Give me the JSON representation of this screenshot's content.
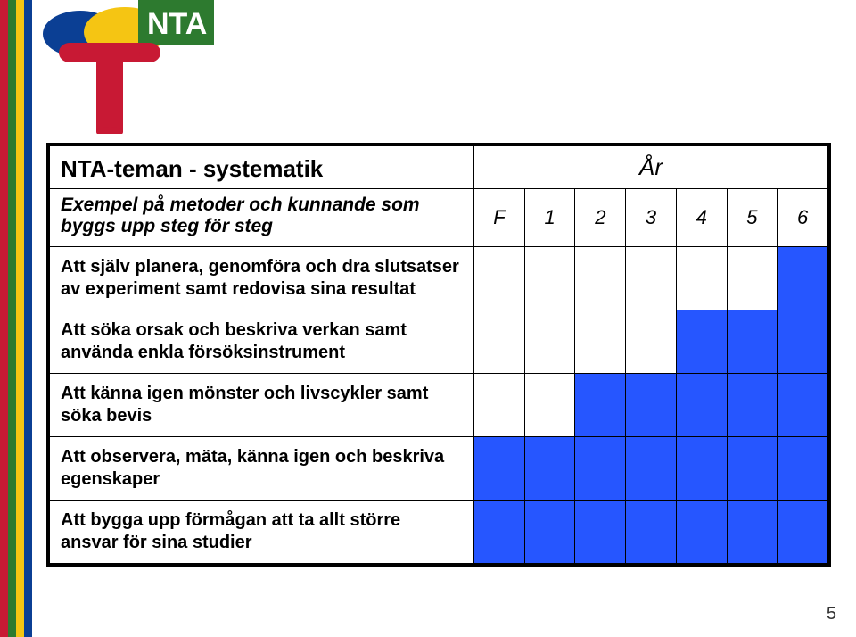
{
  "stripe_colors": [
    "#c81934",
    "#2d7a2f",
    "#f5c513",
    "#0b3f94"
  ],
  "title": "NTA-teman - systematik",
  "year_label": "År",
  "subtitle": "Exempel på metoder och kunnande som byggs upp steg för steg",
  "grades": [
    "F",
    "1",
    "2",
    "3",
    "4",
    "5",
    "6"
  ],
  "rows": [
    {
      "label": "Att själv planera, genomföra och dra slutsatser av experiment samt redovisa sina resultat",
      "cells": [
        0,
        0,
        0,
        0,
        0,
        0,
        1
      ]
    },
    {
      "label": "Att söka orsak och beskriva verkan samt använda enkla försöksinstrument",
      "cells": [
        0,
        0,
        0,
        0,
        1,
        1,
        1
      ]
    },
    {
      "label": "Att känna igen mönster och livscykler samt söka bevis",
      "cells": [
        0,
        0,
        1,
        1,
        1,
        1,
        1
      ]
    },
    {
      "label": "Att observera, mäta, känna igen och beskriva egenskaper",
      "cells": [
        1,
        1,
        1,
        1,
        1,
        1,
        1
      ]
    },
    {
      "label": "Att bygga upp förmågan att ta allt större ansvar för sina studier",
      "cells": [
        1,
        1,
        1,
        1,
        1,
        1,
        1
      ]
    }
  ],
  "page_number": "5",
  "chart_data": {
    "type": "table",
    "title": "NTA-teman - systematik",
    "xlabel": "År",
    "categories": [
      "F",
      "1",
      "2",
      "3",
      "4",
      "5",
      "6"
    ],
    "series": [
      {
        "name": "Att själv planera, genomföra och dra slutsatser av experiment samt redovisa sina resultat",
        "values": [
          0,
          0,
          0,
          0,
          0,
          0,
          1
        ]
      },
      {
        "name": "Att söka orsak och beskriva verkan samt använda enkla försöksinstrument",
        "values": [
          0,
          0,
          0,
          0,
          1,
          1,
          1
        ]
      },
      {
        "name": "Att känna igen mönster och livscykler samt söka bevis",
        "values": [
          0,
          0,
          1,
          1,
          1,
          1,
          1
        ]
      },
      {
        "name": "Att observera, mäta, känna igen och beskriva egenskaper",
        "values": [
          1,
          1,
          1,
          1,
          1,
          1,
          1
        ]
      },
      {
        "name": "Att bygga upp förmågan att ta allt större ansvar för sina studier",
        "values": [
          1,
          1,
          1,
          1,
          1,
          1,
          1
        ]
      }
    ]
  }
}
